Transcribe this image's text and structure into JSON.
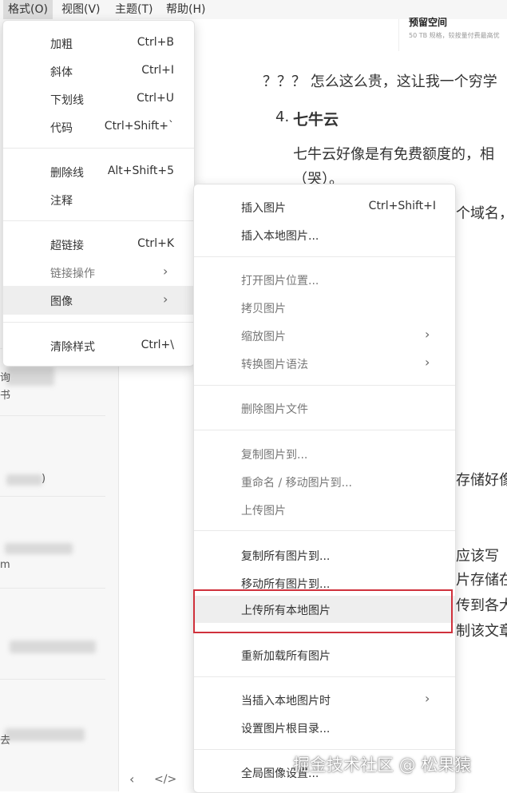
{
  "menubar": {
    "items": [
      "格式(O)",
      "视图(V)",
      "主题(T)",
      "帮助(H)"
    ]
  },
  "document": {
    "image_card_title": "预留空间",
    "image_card_sub": "50 TB 规格，较按量付费最高优",
    "line1": "？？？ 怎么这么贵，这让我一个穷学",
    "heading_number": "4.",
    "heading": "七牛云",
    "para1": "七牛云好像是有免费额度的，相",
    "para1b": "（哭）。",
    "frag1": "个域名，",
    "frag2": "存储好像",
    "frag3": "应该写",
    "frag4": "片存储在",
    "frag5": "传到各大",
    "frag6": "制该文章"
  },
  "sidebar": {
    "frag1": "询",
    "frag2": "书",
    "frag3": ")",
    "frag4": "m",
    "frag5": "去",
    "btn_prev": "‹",
    "btn_source": "</>"
  },
  "format_menu": {
    "items": [
      {
        "label": "加粗",
        "shortcut": "Ctrl+B"
      },
      {
        "label": "斜体",
        "shortcut": "Ctrl+I"
      },
      {
        "label": "下划线",
        "shortcut": "Ctrl+U"
      },
      {
        "label": "代码",
        "shortcut": "Ctrl+Shift+`"
      },
      {
        "label": "删除线",
        "shortcut": "Alt+Shift+5"
      },
      {
        "label": "注释",
        "shortcut": ""
      },
      {
        "label": "超链接",
        "shortcut": "Ctrl+K"
      },
      {
        "label": "链接操作",
        "shortcut": ""
      },
      {
        "label": "图像",
        "shortcut": ""
      },
      {
        "label": "清除样式",
        "shortcut": "Ctrl+\\"
      }
    ],
    "arrow": "›"
  },
  "image_menu": {
    "items": [
      {
        "label": "插入图片",
        "shortcut": "Ctrl+Shift+I"
      },
      {
        "label": "插入本地图片..."
      },
      {
        "label": "打开图片位置..."
      },
      {
        "label": "拷贝图片"
      },
      {
        "label": "缩放图片"
      },
      {
        "label": "转换图片语法"
      },
      {
        "label": "删除图片文件"
      },
      {
        "label": "复制图片到..."
      },
      {
        "label": "重命名 / 移动图片到..."
      },
      {
        "label": "上传图片"
      },
      {
        "label": "复制所有图片到..."
      },
      {
        "label": "移动所有图片到..."
      },
      {
        "label": "上传所有本地图片"
      },
      {
        "label": "重新加载所有图片"
      },
      {
        "label": "当插入本地图片时"
      },
      {
        "label": "设置图片根目录..."
      },
      {
        "label": "全局图像设置..."
      }
    ],
    "arrow": "›"
  },
  "watermark": "掘金技术社区 @ 松果猿",
  "colors": {
    "highlight_border": "#d0313c",
    "menu_hover": "#eeeeee",
    "menubar_bg": "#f6f6f6"
  }
}
